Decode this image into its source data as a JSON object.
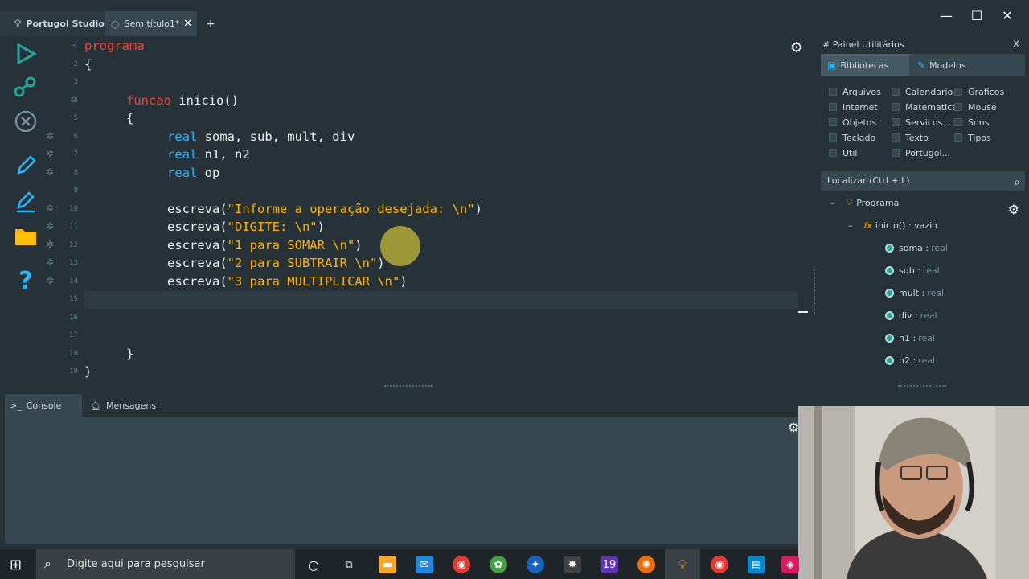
{
  "tabs": {
    "home": "Portugol Studio",
    "doc": "Sem título1*",
    "add": "+"
  },
  "window": {
    "minimize": "—",
    "maximize": "☐",
    "close": "✕"
  },
  "editor": {
    "lines": [
      {
        "num": "1",
        "parts": [
          [
            "kw",
            "programa"
          ]
        ]
      },
      {
        "num": "2",
        "parts": [
          [
            "fn",
            "{"
          ]
        ]
      },
      {
        "num": "3",
        "parts": []
      },
      {
        "num": "4",
        "parts": [
          [
            "kw",
            "funcao"
          ],
          [
            "fn",
            " inicio()"
          ]
        ]
      },
      {
        "num": "5",
        "parts": [
          [
            "fn",
            "{"
          ]
        ]
      },
      {
        "num": "6",
        "parts": [
          [
            "ty",
            "real"
          ],
          [
            "fn",
            " soma, sub, mult, div"
          ]
        ]
      },
      {
        "num": "7",
        "parts": [
          [
            "ty",
            "real"
          ],
          [
            "fn",
            " n1, n2"
          ]
        ]
      },
      {
        "num": "8",
        "parts": [
          [
            "ty",
            "real"
          ],
          [
            "fn",
            " op"
          ]
        ]
      },
      {
        "num": "9",
        "parts": []
      },
      {
        "num": "10",
        "parts": [
          [
            "fn",
            "escreva("
          ],
          [
            "st",
            "\"Informe a operação desejada: \\n\""
          ],
          [
            "fn",
            ")"
          ]
        ]
      },
      {
        "num": "11",
        "parts": [
          [
            "fn",
            "escreva("
          ],
          [
            "st",
            "\"DIGITE: \\n\""
          ],
          [
            "fn",
            ")"
          ]
        ]
      },
      {
        "num": "12",
        "parts": [
          [
            "fn",
            "escreva("
          ],
          [
            "st",
            "\"1 para SOMAR \\n\""
          ],
          [
            "fn",
            ")"
          ]
        ]
      },
      {
        "num": "13",
        "parts": [
          [
            "fn",
            "escreva("
          ],
          [
            "st",
            "\"2 para SUBTRAIR \\n\""
          ],
          [
            "fn",
            ")"
          ]
        ]
      },
      {
        "num": "14",
        "parts": [
          [
            "fn",
            "escreva("
          ],
          [
            "st",
            "\"3 para MULTIPLICAR \\n\""
          ],
          [
            "fn",
            ")"
          ]
        ]
      },
      {
        "num": "15",
        "parts": []
      },
      {
        "num": "16",
        "parts": []
      },
      {
        "num": "17",
        "parts": []
      },
      {
        "num": "18",
        "parts": [
          [
            "fn",
            "}"
          ]
        ]
      },
      {
        "num": "19",
        "parts": [
          [
            "fn",
            "}"
          ]
        ]
      }
    ]
  },
  "panel": {
    "title": "# Painel Utilitários",
    "close": "x",
    "tab_libraries": "Bibliotecas",
    "tab_models": "Modelos",
    "libraries": [
      "Arquivos",
      "Calendario",
      "Graficos",
      "Internet",
      "Matematica",
      "Mouse",
      "Objetos",
      "Servicos...",
      "Sons",
      "Teclado",
      "Texto",
      "Tipos",
      "Util",
      "Portugol..."
    ],
    "search_placeholder": "Localizar (Ctrl + L)",
    "tree": {
      "root": "Programa",
      "func": "inicio() : vazio",
      "vars": [
        {
          "name": "soma :",
          "type": "real"
        },
        {
          "name": "sub :",
          "type": "real"
        },
        {
          "name": "mult :",
          "type": "real"
        },
        {
          "name": "div :",
          "type": "real"
        },
        {
          "name": "n1 :",
          "type": "real"
        },
        {
          "name": "n2 :",
          "type": "real"
        }
      ]
    }
  },
  "console": {
    "tab_console": "Console",
    "tab_messages": "Mensagens"
  },
  "taskbar": {
    "search_placeholder": "Digite aqui para pesquisar",
    "badge_19": "19"
  }
}
